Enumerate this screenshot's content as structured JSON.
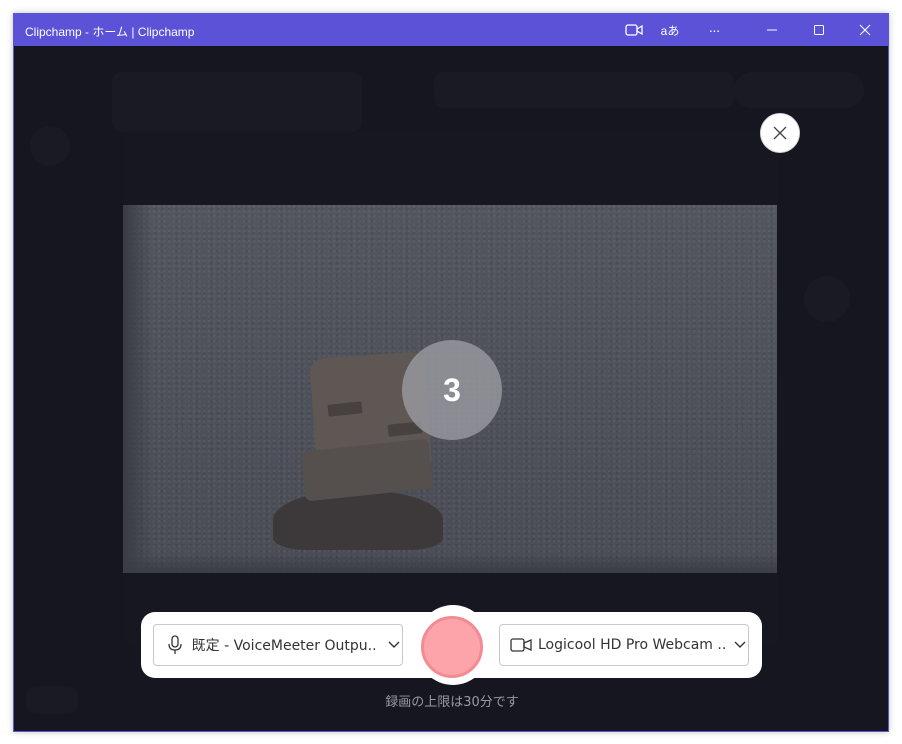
{
  "window": {
    "title": "Clipchamp - ホーム | Clipchamp",
    "accent_color": "#5b52d8",
    "titlebar_icons": [
      "video-camera-icon",
      "translate-icon",
      "more-icon",
      "minimize-icon",
      "maximize-icon",
      "close-icon"
    ],
    "translate_glyph": "aあ",
    "more_glyph": "···"
  },
  "recorder": {
    "countdown": "3",
    "close_icon": "close-icon",
    "microphone": {
      "icon": "microphone-icon",
      "label": "既定 - VoiceMeeter Outpu...",
      "chevron": "chevron-down-icon"
    },
    "camera": {
      "icon": "video-camera-icon",
      "label": "Logicool HD Pro Webcam ...",
      "chevron": "chevron-down-icon"
    },
    "record_button_color": "#fca4aa",
    "limit_text": "録画の上限は30分です"
  }
}
